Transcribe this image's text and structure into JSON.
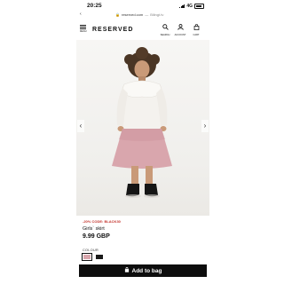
{
  "status_bar": {
    "time": "20:25",
    "network": "4G"
  },
  "url_bar": {
    "host": "reserved.com",
    "separator": "—",
    "subtitle": "Bilingt.tv"
  },
  "header": {
    "logo": "RESERVED",
    "menu_label": "MENU",
    "search_label": "SEARCH",
    "account_label": "ACCOUNT",
    "cart_label": "CART"
  },
  "gallery": {
    "prev_glyph": "‹",
    "next_glyph": "›"
  },
  "product": {
    "promo": "-20% CODE: BLACK30",
    "name": "Girls` skirt",
    "price": "9.99 GBP",
    "colour_label": "COLOUR",
    "colours": [
      "pink",
      "black"
    ]
  },
  "add_to_bag": {
    "label": "Add to bag"
  },
  "colors": {
    "promo": "#c4342d",
    "button": "#0d0d0d",
    "swatch_pink": "#d9a6ad",
    "swatch_black": "#1a1a1a"
  }
}
